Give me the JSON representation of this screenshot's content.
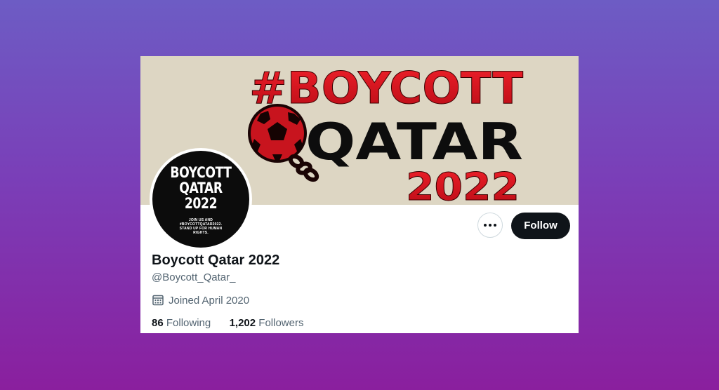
{
  "banner": {
    "line1": "#BOYCOTT",
    "line2": "QATAR",
    "line3": "2022"
  },
  "avatar": {
    "line1": "BOYCOTT",
    "line2": "QATAR",
    "line3": "2022",
    "small_text": "JOIN US AND #BOYCOTTQATAR2022. STAND UP FOR HUMAN RIGHTS."
  },
  "actions": {
    "more_label": "More",
    "follow_label": "Follow"
  },
  "profile": {
    "display_name": "Boycott Qatar 2022",
    "handle": "@Boycott_Qatar_",
    "joined": "Joined April 2020"
  },
  "stats": {
    "following_count": "86",
    "following_label": "Following",
    "followers_count": "1,202",
    "followers_label": "Followers"
  },
  "colors": {
    "background_top": "#6d5cc4",
    "background_bottom": "#8a1f9e",
    "banner_bg": "#ddd6c3",
    "banner_red": "#d4101c",
    "text_primary": "#0f1419",
    "text_secondary": "#536471"
  }
}
